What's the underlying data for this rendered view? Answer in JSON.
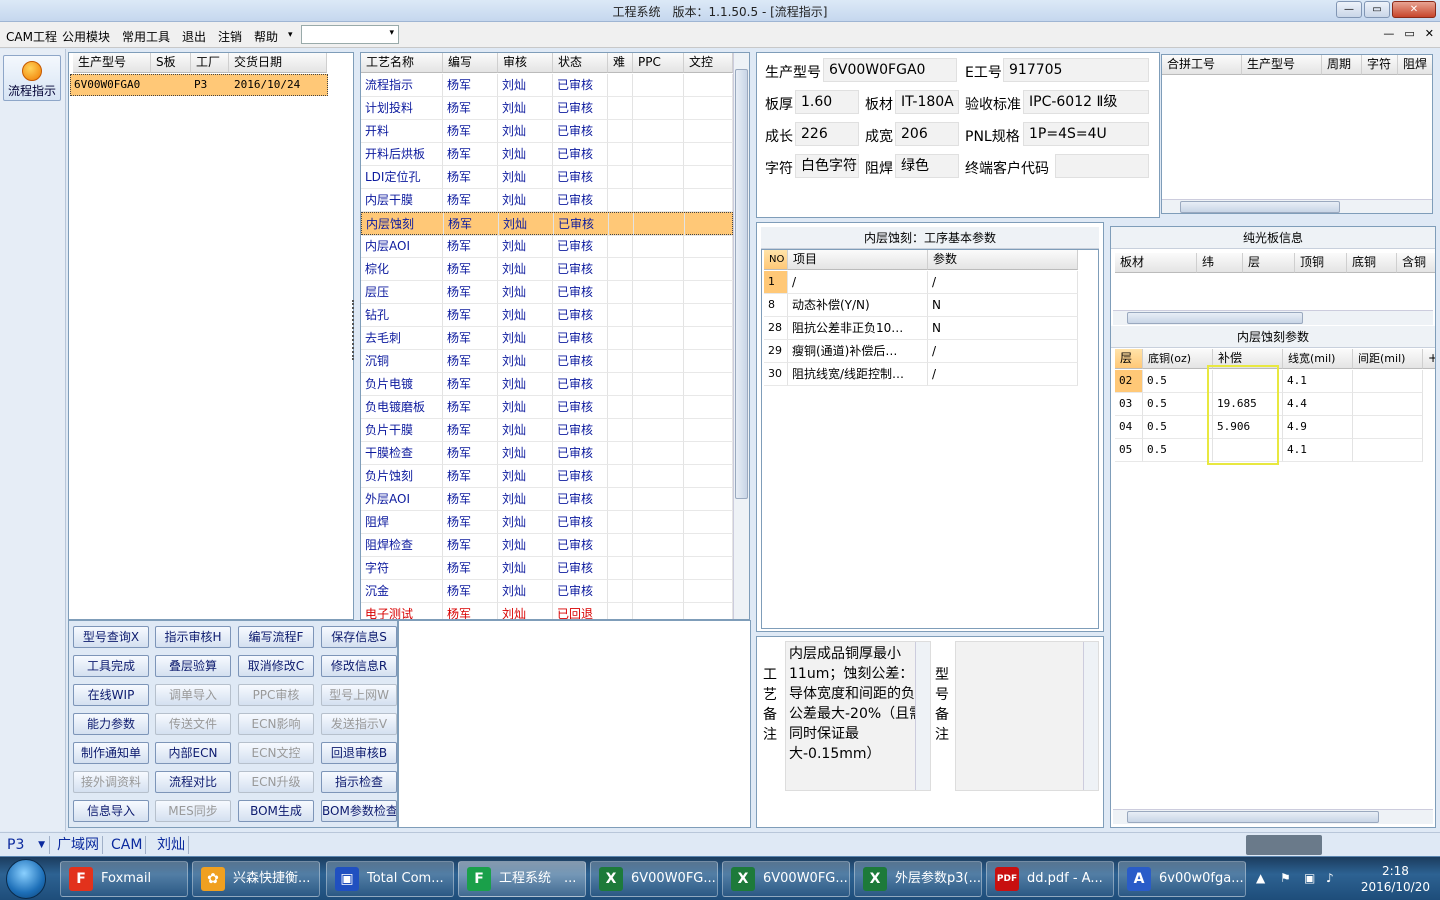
{
  "window": {
    "title": "工程系统　版本：1.1.50.5 - [流程指示]",
    "buttons": [
      "—",
      "▭",
      "✕"
    ]
  },
  "menu": [
    "CAM工程",
    "公用模块",
    "常用工具",
    "退出",
    "注销",
    "帮助"
  ],
  "menu_extra": "▾",
  "mdi_buttons": [
    "—",
    "▭",
    "✕"
  ],
  "sidebar": {
    "flow_button": "流程指示"
  },
  "orders": {
    "headers": [
      "生产型号",
      "S板",
      "工厂",
      "交货日期"
    ],
    "rows": [
      [
        "6V00W0FGA0",
        "",
        "P3",
        "2016/10/24"
      ]
    ]
  },
  "process": {
    "headers": [
      "工艺名称",
      "编写",
      "审核",
      "状态",
      "难",
      "PPC",
      "文控"
    ],
    "rows": [
      [
        "流程指示",
        "杨军",
        "刘灿",
        "已审核"
      ],
      [
        "计划投料",
        "杨军",
        "刘灿",
        "已审核"
      ],
      [
        "开料",
        "杨军",
        "刘灿",
        "已审核"
      ],
      [
        "开料后烘板",
        "杨军",
        "刘灿",
        "已审核"
      ],
      [
        "LDI定位孔",
        "杨军",
        "刘灿",
        "已审核"
      ],
      [
        "内层干膜",
        "杨军",
        "刘灿",
        "已审核"
      ],
      [
        "内层蚀刻",
        "杨军",
        "刘灿",
        "已审核"
      ],
      [
        "内层AOI",
        "杨军",
        "刘灿",
        "已审核"
      ],
      [
        "棕化",
        "杨军",
        "刘灿",
        "已审核"
      ],
      [
        "层压",
        "杨军",
        "刘灿",
        "已审核"
      ],
      [
        "钻孔",
        "杨军",
        "刘灿",
        "已审核"
      ],
      [
        "去毛刺",
        "杨军",
        "刘灿",
        "已审核"
      ],
      [
        "沉铜",
        "杨军",
        "刘灿",
        "已审核"
      ],
      [
        "负片电镀",
        "杨军",
        "刘灿",
        "已审核"
      ],
      [
        "负电镀磨板",
        "杨军",
        "刘灿",
        "已审核"
      ],
      [
        "负片干膜",
        "杨军",
        "刘灿",
        "已审核"
      ],
      [
        "干膜检查",
        "杨军",
        "刘灿",
        "已审核"
      ],
      [
        "负片蚀刻",
        "杨军",
        "刘灿",
        "已审核"
      ],
      [
        "外层AOI",
        "杨军",
        "刘灿",
        "已审核"
      ],
      [
        "阻焊",
        "杨军",
        "刘灿",
        "已审核"
      ],
      [
        "阻焊检查",
        "杨军",
        "刘灿",
        "已审核"
      ],
      [
        "字符",
        "杨军",
        "刘灿",
        "已审核"
      ],
      [
        "沉金",
        "杨军",
        "刘灿",
        "已审核"
      ],
      [
        "电子测试",
        "杨军",
        "刘灿",
        "已回退"
      ]
    ],
    "selected_index": 6
  },
  "actions": [
    [
      "型号查询X",
      "指示审核H",
      "编写流程F",
      "保存信息S"
    ],
    [
      "工具完成",
      "叠层验算",
      "取消修改C",
      "修改信息R"
    ],
    [
      "在线WIP",
      "调单导入",
      "PPC审核",
      "型号上网W"
    ],
    [
      "能力参数",
      "传送文件",
      "ECN影响",
      "发送指示V"
    ],
    [
      "制作通知单",
      "内部ECN",
      "ECN文控",
      "回退审核B"
    ],
    [
      "接外调资料",
      "流程对比",
      "ECN升级",
      "指示检查"
    ],
    [
      "信息导入",
      "MES同步",
      "BOM生成",
      "BOM参数检查"
    ]
  ],
  "actions_disabled": [
    [
      2,
      1
    ],
    [
      2,
      2
    ],
    [
      2,
      3
    ],
    [
      3,
      1
    ],
    [
      3,
      2
    ],
    [
      3,
      3
    ],
    [
      4,
      2
    ],
    [
      5,
      0
    ],
    [
      5,
      2
    ],
    [
      6,
      1
    ]
  ],
  "info": {
    "model_label": "生产型号",
    "model": "6V00W0FGA0",
    "eno_label": "E工号",
    "eno": "917705",
    "thick_label": "板厚",
    "thick": "1.60",
    "material_label": "板材",
    "material": "IT-180A",
    "std_label": "验收标准",
    "std": "IPC-6012 Ⅱ级",
    "len_label": "成长",
    "len": "226",
    "wid_label": "成宽",
    "wid": "206",
    "pnl_label": "PNL规格",
    "pnl": "1P=4S=4U",
    "char_label": "字符",
    "char": "白色字符",
    "mask_label": "阻焊",
    "mask": "绿色",
    "cust_label": "终端客户代码",
    "cust": ""
  },
  "merge": {
    "headers": [
      "合拼工号",
      "生产型号",
      "周期",
      "字符",
      "阻焊"
    ]
  },
  "params": {
    "title": "内层蚀刻：工序基本参数",
    "headers": [
      "NO",
      "项目",
      "参数"
    ],
    "rows": [
      [
        "1",
        "/",
        "/"
      ],
      [
        "8",
        "动态补偿(Y/N)",
        "N"
      ],
      [
        "28",
        "阻抗公差非正负10…",
        "N"
      ],
      [
        "29",
        "瘦铜(通道)补偿后…",
        "/"
      ],
      [
        "30",
        "阻抗线宽/线距控制…",
        "/"
      ]
    ]
  },
  "bare": {
    "title": "纯光板信息",
    "headers": [
      "板材",
      "纬",
      "层",
      "顶铜",
      "底铜",
      "含铜"
    ]
  },
  "etch": {
    "title": "内层蚀刻参数",
    "headers": [
      "层",
      "底铜(oz)",
      "补偿",
      "线宽(mil)",
      "间距(mil)",
      "+"
    ],
    "rows": [
      [
        "02",
        "0.5",
        "",
        "4.1",
        ""
      ],
      [
        "03",
        "0.5",
        "19.685",
        "4.4",
        ""
      ],
      [
        "04",
        "0.5",
        "5.906",
        "4.9",
        ""
      ],
      [
        "05",
        "0.5",
        "",
        "4.1",
        ""
      ]
    ]
  },
  "notes": {
    "proc_label": "工艺备注",
    "proc_text": "内层成品铜厚最小11um；蚀刻公差：导体宽度和间距的负公差最大-20%（且需同时保证最大-0.15mm）",
    "model_label": "型号备注",
    "model_text": ""
  },
  "status": {
    "factory": "P3",
    "tabs": [
      "广域网",
      "CAM",
      "刘灿"
    ]
  },
  "taskbar": {
    "items": [
      {
        "label": "Foxmail",
        "icon": "foxmail-icon",
        "glyph": "F",
        "color": "#e2321c"
      },
      {
        "label": "兴森快捷衡...",
        "icon": "shell-icon",
        "glyph": "✿",
        "color": "#f0a020"
      },
      {
        "label": "Total Com...",
        "icon": "floppy-icon",
        "glyph": "▣",
        "color": "#2050c0"
      },
      {
        "label": "工程系统　...",
        "icon": "app-f-icon",
        "glyph": "F",
        "color": "#1aa04a"
      },
      {
        "label": "6V00W0FG...",
        "icon": "excel-icon",
        "glyph": "X",
        "color": "#1d7a3a"
      },
      {
        "label": "6V00W0FG...",
        "icon": "excel-icon",
        "glyph": "X",
        "color": "#1d7a3a"
      },
      {
        "label": "外层参数p3(...",
        "icon": "excel-icon",
        "glyph": "X",
        "color": "#1d7a3a"
      },
      {
        "label": "dd.pdf - A...",
        "icon": "pdf-icon",
        "glyph": "PDF",
        "color": "#c81010"
      },
      {
        "label": "6v00w0fga...",
        "icon": "word-icon",
        "glyph": "A",
        "color": "#2a5cc8"
      }
    ],
    "time": "2:18",
    "date": "2016/10/20"
  }
}
